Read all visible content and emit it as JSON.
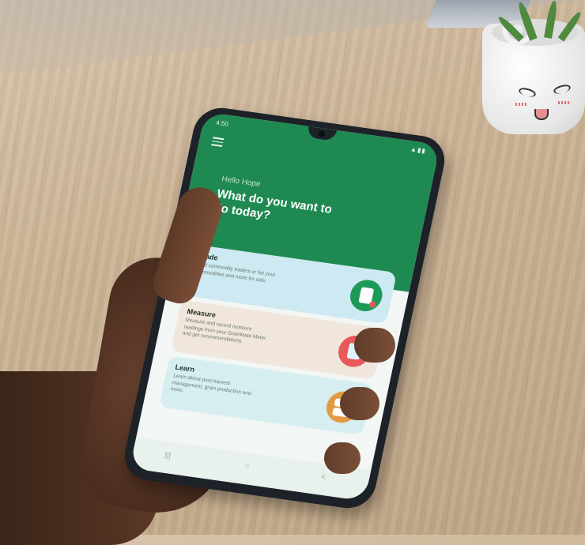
{
  "status_bar": {
    "time": "4:50",
    "icons": "▲▮▮"
  },
  "app": {
    "greeting": "Hello Hope",
    "headline": "What do you want to do today?",
    "cards": [
      {
        "title": "Trade",
        "description": "Find commodity traders or list your commodities and more for sale.",
        "icon": "market-stall-icon",
        "color": "#cde9f2",
        "icon_color": "#1e9a58"
      },
      {
        "title": "Measure",
        "description": "Measure and record moisture readings from your GrainMate Meter and get recommendations.",
        "icon": "moisture-meter-icon",
        "color": "#f1e6dc",
        "icon_color": "#e85a5a"
      },
      {
        "title": "Learn",
        "description": "Learn about post-harvest management, grain production and more.",
        "icon": "chat-learn-icon",
        "color": "#d6eef0",
        "icon_color": "#e49a45"
      }
    ]
  },
  "nav": {
    "recents": "|||",
    "home": "○",
    "back": "<"
  },
  "colors": {
    "header_green": "#1e8a52"
  }
}
